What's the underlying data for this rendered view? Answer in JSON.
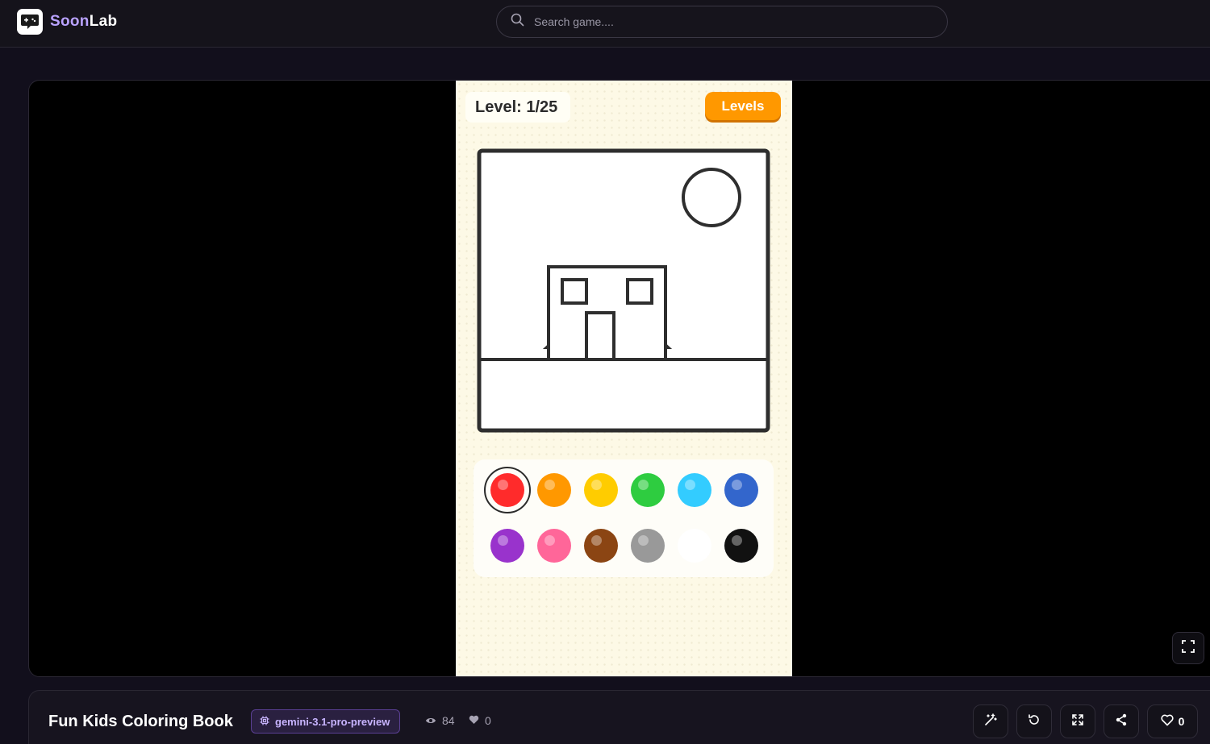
{
  "header": {
    "brand_part1": "Soon",
    "brand_part2": "Lab",
    "search_placeholder": "Search game...."
  },
  "game": {
    "level_text": "Level: 1/25",
    "levels_button": "Levels",
    "palette": [
      {
        "color": "#ff2b2b",
        "selected": true
      },
      {
        "color": "#ff9800",
        "selected": false
      },
      {
        "color": "#ffcc00",
        "selected": false
      },
      {
        "color": "#2ecc40",
        "selected": false
      },
      {
        "color": "#33ccff",
        "selected": false
      },
      {
        "color": "#3366cc",
        "selected": false
      },
      {
        "color": "#9933cc",
        "selected": false
      },
      {
        "color": "#ff6699",
        "selected": false
      },
      {
        "color": "#8b4513",
        "selected": false
      },
      {
        "color": "#999999",
        "selected": false
      },
      {
        "color": "#ffffff",
        "selected": false
      },
      {
        "color": "#111111",
        "selected": false
      }
    ]
  },
  "info": {
    "title": "Fun Kids Coloring Book",
    "model": "gemini-3.1-pro-preview",
    "views": "84",
    "likes": "0",
    "like_button_count": "0"
  },
  "colors": {
    "accent": "#b9a2ff",
    "levels_button": "#ff9800",
    "page_bg": "#120f1c"
  }
}
